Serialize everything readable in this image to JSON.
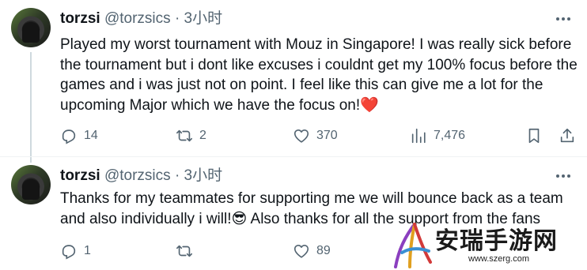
{
  "tweets": [
    {
      "name": "torzsi",
      "handle": "@torzsics",
      "dot": "·",
      "time": "3小时",
      "text": "Played my worst tournament with Mouz in Singapore! I was really sick before the tournament but i dont like excuses i couldnt get my 100% focus before the games and i was just not on point. I feel like this can give me a lot for the upcoming Major which we have the focus on!",
      "emoji": "❤️",
      "replies": "14",
      "retweets": "2",
      "likes": "370",
      "views": "7,476"
    },
    {
      "name": "torzsi",
      "handle": "@torzsics",
      "dot": "·",
      "time": "3小时",
      "text_before_emoji": "Thanks for my teammates for supporting me we will bounce back as a team and also individually i will!",
      "emoji": "😎",
      "text_after_emoji": " Also thanks for all the support from the fans",
      "replies": "1",
      "retweets": "",
      "likes": "89"
    }
  ],
  "watermark": {
    "text": "安瑞手游网",
    "url": "www.szerg.com"
  },
  "colors": {
    "text": "#0f1419",
    "secondary": "#536471",
    "heart": "#f91880",
    "thread_line": "#cfd9de"
  }
}
